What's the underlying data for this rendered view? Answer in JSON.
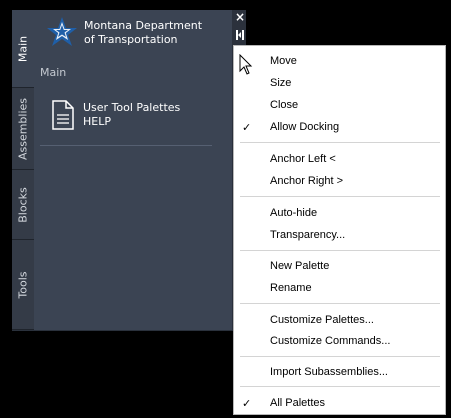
{
  "palette": {
    "tabs": [
      {
        "label": "Main",
        "active": true
      },
      {
        "label": "Assemblies",
        "active": false
      },
      {
        "label": "Blocks",
        "active": false
      },
      {
        "label": "Tools",
        "active": false
      }
    ],
    "org_name_line1": "Montana Department",
    "org_name_line2": "of Transportation",
    "section_title": "Main",
    "item_line1": "User Tool Palettes",
    "item_line2": "HELP",
    "logo_icon": "montana-star-logo-icon",
    "doc_icon": "document-icon"
  },
  "controls": {
    "close_glyph": "×",
    "properties_icon": "palette-properties-icon"
  },
  "menu": {
    "items": [
      {
        "label": "Move",
        "checked": false
      },
      {
        "label": "Size",
        "checked": false
      },
      {
        "label": "Close",
        "checked": false
      },
      {
        "label": "Allow Docking",
        "checked": true
      },
      {
        "label": "Anchor Left  <",
        "checked": false
      },
      {
        "label": "Anchor Right  >",
        "checked": false
      },
      {
        "label": "Auto-hide",
        "checked": false
      },
      {
        "label": "Transparency...",
        "checked": false
      },
      {
        "label": "New Palette",
        "checked": false
      },
      {
        "label": "Rename",
        "checked": false
      },
      {
        "label": "Customize Palettes...",
        "checked": false
      },
      {
        "label": "Customize Commands...",
        "checked": false
      },
      {
        "label": "Import Subassemblies...",
        "checked": false
      },
      {
        "label": "All Palettes",
        "checked": true
      }
    ],
    "check_glyph": "✓"
  },
  "colors": {
    "palette_bg": "#3b4453",
    "tab_bg": "#343b47",
    "menu_bg": "#ffffff",
    "logo_blue": "#1f5fa8"
  }
}
